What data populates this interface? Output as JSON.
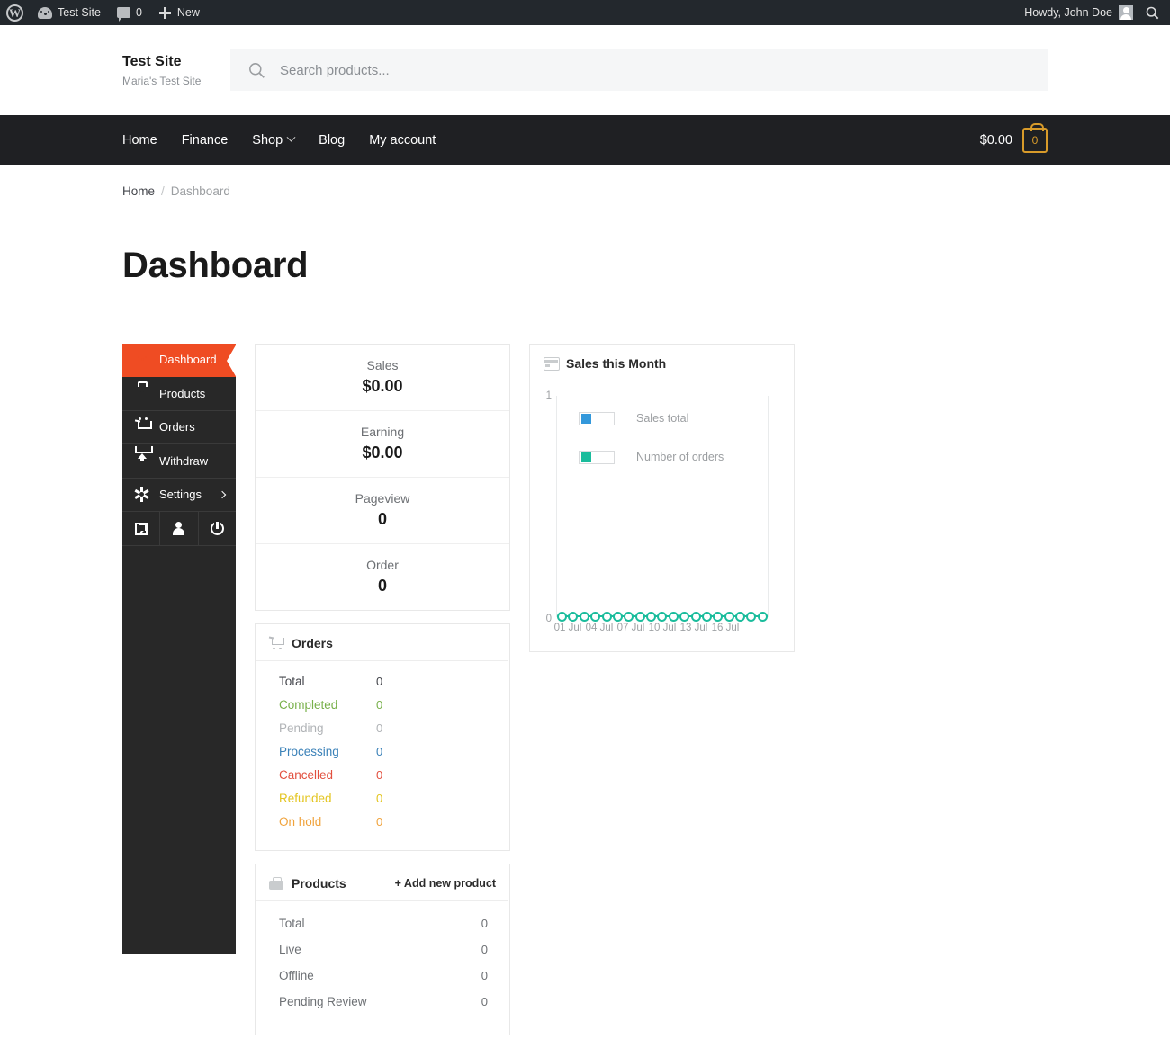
{
  "adminbar": {
    "wp_logo": "wordpress-logo-icon",
    "site_name": "Test Site",
    "comments_icon": "comment-bubble-icon",
    "comments_count": "0",
    "new_label": "New",
    "howdy": "Howdy, John Doe",
    "search_icon": "search-icon"
  },
  "header": {
    "brand_title": "Test Site",
    "brand_tagline": "Maria's Test Site",
    "search": {
      "placeholder": "Search products...",
      "value": "",
      "icon": "search-icon"
    }
  },
  "nav": {
    "items": [
      {
        "label": "Home",
        "has_dropdown": false
      },
      {
        "label": "Finance",
        "has_dropdown": false
      },
      {
        "label": "Shop",
        "has_dropdown": true
      },
      {
        "label": "Blog",
        "has_dropdown": false
      },
      {
        "label": "My account",
        "has_dropdown": false
      }
    ],
    "cart": {
      "total": "$0.00",
      "count": "0",
      "icon": "shopping-bag-icon",
      "color": "#d89b2a"
    }
  },
  "breadcrumb": {
    "home": "Home",
    "separator": "/",
    "current": "Dashboard"
  },
  "page": {
    "title": "Dashboard"
  },
  "sidebar": {
    "accent_color": "#ef4c23",
    "items": [
      {
        "label": "Dashboard",
        "icon": "gauge-icon",
        "active": true,
        "chevron": false
      },
      {
        "label": "Products",
        "icon": "briefcase-icon",
        "active": false,
        "chevron": false
      },
      {
        "label": "Orders",
        "icon": "cart-icon",
        "active": false,
        "chevron": false
      },
      {
        "label": "Withdraw",
        "icon": "upload-icon",
        "active": false,
        "chevron": false
      },
      {
        "label": "Settings",
        "icon": "gear-icon",
        "active": false,
        "chevron": true
      }
    ],
    "icon_buttons": [
      {
        "name": "visit-store",
        "icon": "external-link-icon"
      },
      {
        "name": "profile",
        "icon": "user-icon"
      },
      {
        "name": "logout",
        "icon": "power-icon"
      }
    ]
  },
  "stats": {
    "rows": [
      {
        "label": "Sales",
        "value": "$0.00"
      },
      {
        "label": "Earning",
        "value": "$0.00"
      },
      {
        "label": "Pageview",
        "value": "0"
      },
      {
        "label": "Order",
        "value": "0"
      }
    ]
  },
  "orders_card": {
    "title": "Orders",
    "icon": "cart-icon",
    "rows": [
      {
        "label": "Total",
        "value": "0",
        "color": "#43454b"
      },
      {
        "label": "Completed",
        "value": "0",
        "color": "#78b04a"
      },
      {
        "label": "Pending",
        "value": "0",
        "color": "#b0b3b6"
      },
      {
        "label": "Processing",
        "value": "0",
        "color": "#3a81b8"
      },
      {
        "label": "Cancelled",
        "value": "0",
        "color": "#e2503f"
      },
      {
        "label": "Refunded",
        "value": "0",
        "color": "#e3c520"
      },
      {
        "label": "On hold",
        "value": "0",
        "color": "#f0a33c"
      }
    ]
  },
  "products_card": {
    "title": "Products",
    "icon": "briefcase-icon",
    "add_link": "+ Add new product",
    "rows": [
      {
        "label": "Total",
        "value": "0"
      },
      {
        "label": "Live",
        "value": "0"
      },
      {
        "label": "Offline",
        "value": "0"
      },
      {
        "label": "Pending Review",
        "value": "0"
      }
    ]
  },
  "chart_card": {
    "title": "Sales this Month",
    "icon": "chart-card-icon"
  },
  "chart_data": {
    "type": "line",
    "title": "Sales this Month",
    "xlabel": "",
    "ylabel": "",
    "ylim": [
      0,
      1
    ],
    "yticks": [
      "0",
      "1"
    ],
    "grid": false,
    "legend_position": "inside-top-left",
    "x": [
      "01 Jul",
      "02 Jul",
      "03 Jul",
      "04 Jul",
      "05 Jul",
      "06 Jul",
      "07 Jul",
      "08 Jul",
      "09 Jul",
      "10 Jul",
      "11 Jul",
      "12 Jul",
      "13 Jul",
      "14 Jul",
      "15 Jul",
      "16 Jul",
      "17 Jul",
      "18 Jul",
      "19 Jul"
    ],
    "xtick_labels": [
      "01 Jul",
      "04 Jul",
      "07 Jul",
      "10 Jul",
      "13 Jul",
      "16 Jul"
    ],
    "xtick_indices": [
      0,
      3,
      6,
      9,
      12,
      15
    ],
    "series": [
      {
        "name": "Sales total",
        "color": "#3398db",
        "values": [
          0,
          0,
          0,
          0,
          0,
          0,
          0,
          0,
          0,
          0,
          0,
          0,
          0,
          0,
          0,
          0,
          0,
          0,
          0
        ]
      },
      {
        "name": "Number of orders",
        "color": "#1abc9c",
        "values": [
          0,
          0,
          0,
          0,
          0,
          0,
          0,
          0,
          0,
          0,
          0,
          0,
          0,
          0,
          0,
          0,
          0,
          0,
          0
        ]
      }
    ]
  }
}
